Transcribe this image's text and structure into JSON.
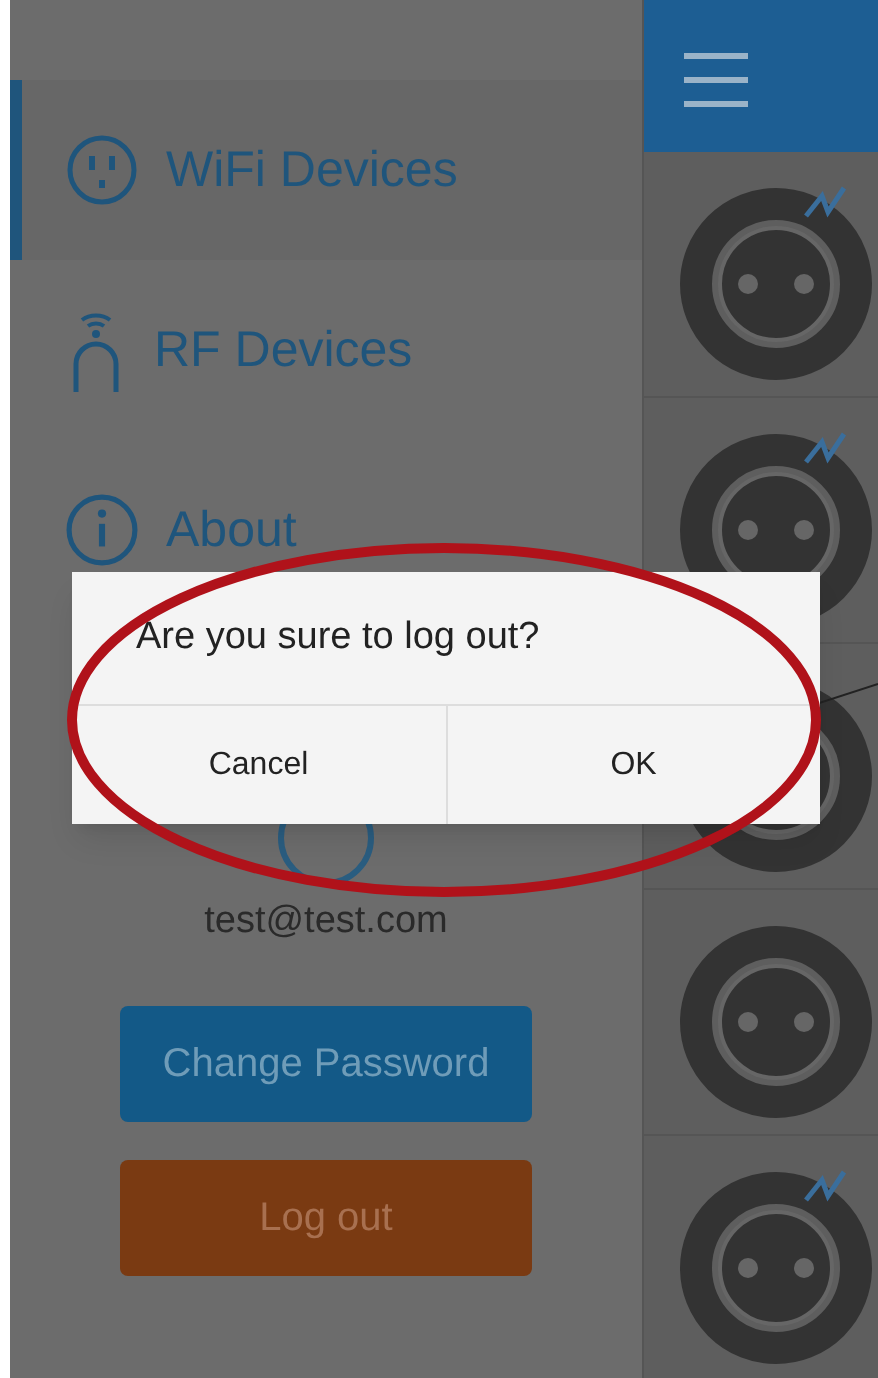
{
  "drawer": {
    "items": [
      {
        "label": "WiFi Devices",
        "kind": "outlet",
        "selected": true
      },
      {
        "label": "RF Devices",
        "kind": "rf",
        "selected": false
      },
      {
        "label": "About",
        "kind": "info",
        "selected": false
      }
    ],
    "account": {
      "email": "test@test.com"
    },
    "buttons": [
      {
        "label": "Change Password",
        "kind": "primary"
      },
      {
        "label": "Log out",
        "kind": "danger"
      }
    ]
  },
  "device_list": {
    "rows": [
      {
        "metering": true
      },
      {
        "metering": true
      },
      {
        "metering": false
      },
      {
        "metering": false
      },
      {
        "metering": true
      }
    ]
  },
  "dialog": {
    "message": "Are you sure to log out?",
    "buttons": [
      "Cancel",
      "OK"
    ]
  }
}
